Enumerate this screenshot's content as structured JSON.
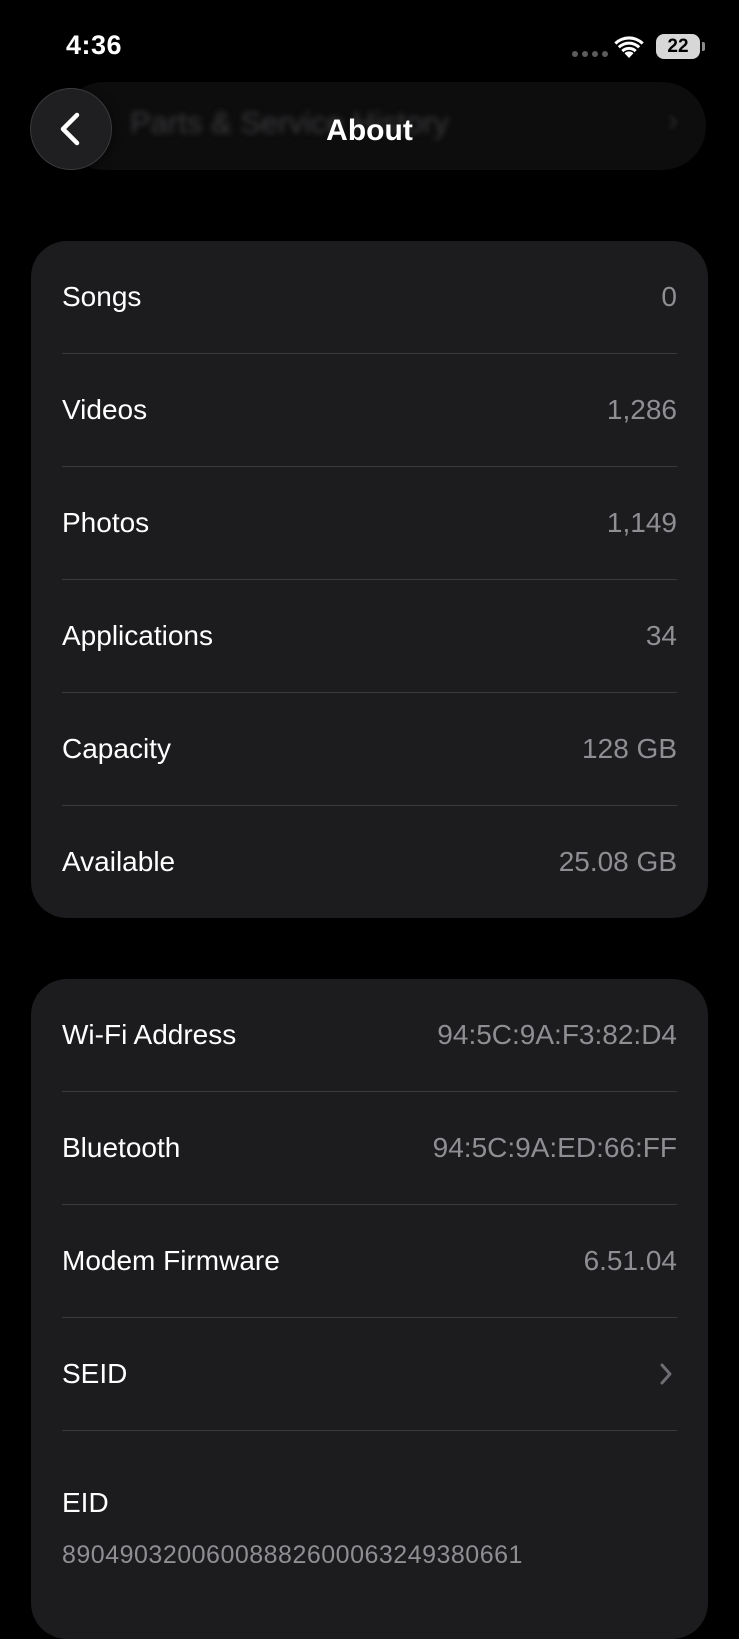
{
  "status_bar": {
    "time": "4:36",
    "battery": "22"
  },
  "header": {
    "title": "About",
    "back_label": "",
    "background_ghost_text": "Parts & Service History"
  },
  "storage_group": [
    {
      "label": "Songs",
      "value": "0"
    },
    {
      "label": "Videos",
      "value": "1,286"
    },
    {
      "label": "Photos",
      "value": "1,149"
    },
    {
      "label": "Applications",
      "value": "34"
    },
    {
      "label": "Capacity",
      "value": "128 GB"
    },
    {
      "label": "Available",
      "value": "25.08 GB"
    }
  ],
  "network_group": [
    {
      "label": "Wi-Fi Address",
      "value": "94:5C:9A:F3:82:D4"
    },
    {
      "label": "Bluetooth",
      "value": "94:5C:9A:ED:66:FF"
    },
    {
      "label": "Modem Firmware",
      "value": "6.51.04"
    },
    {
      "label": "SEID",
      "value": ""
    },
    {
      "label": "EID",
      "value": "89049032006008882600063249380661"
    }
  ],
  "colors": {
    "background": "#000000",
    "card": "#1c1c1e",
    "secondary_text": "#8e8e93",
    "separator": "#3a3a3c"
  },
  "icons": {
    "back": "chevron-left-icon",
    "disclosure": "chevron-right-icon",
    "wifi": "wifi-icon"
  }
}
